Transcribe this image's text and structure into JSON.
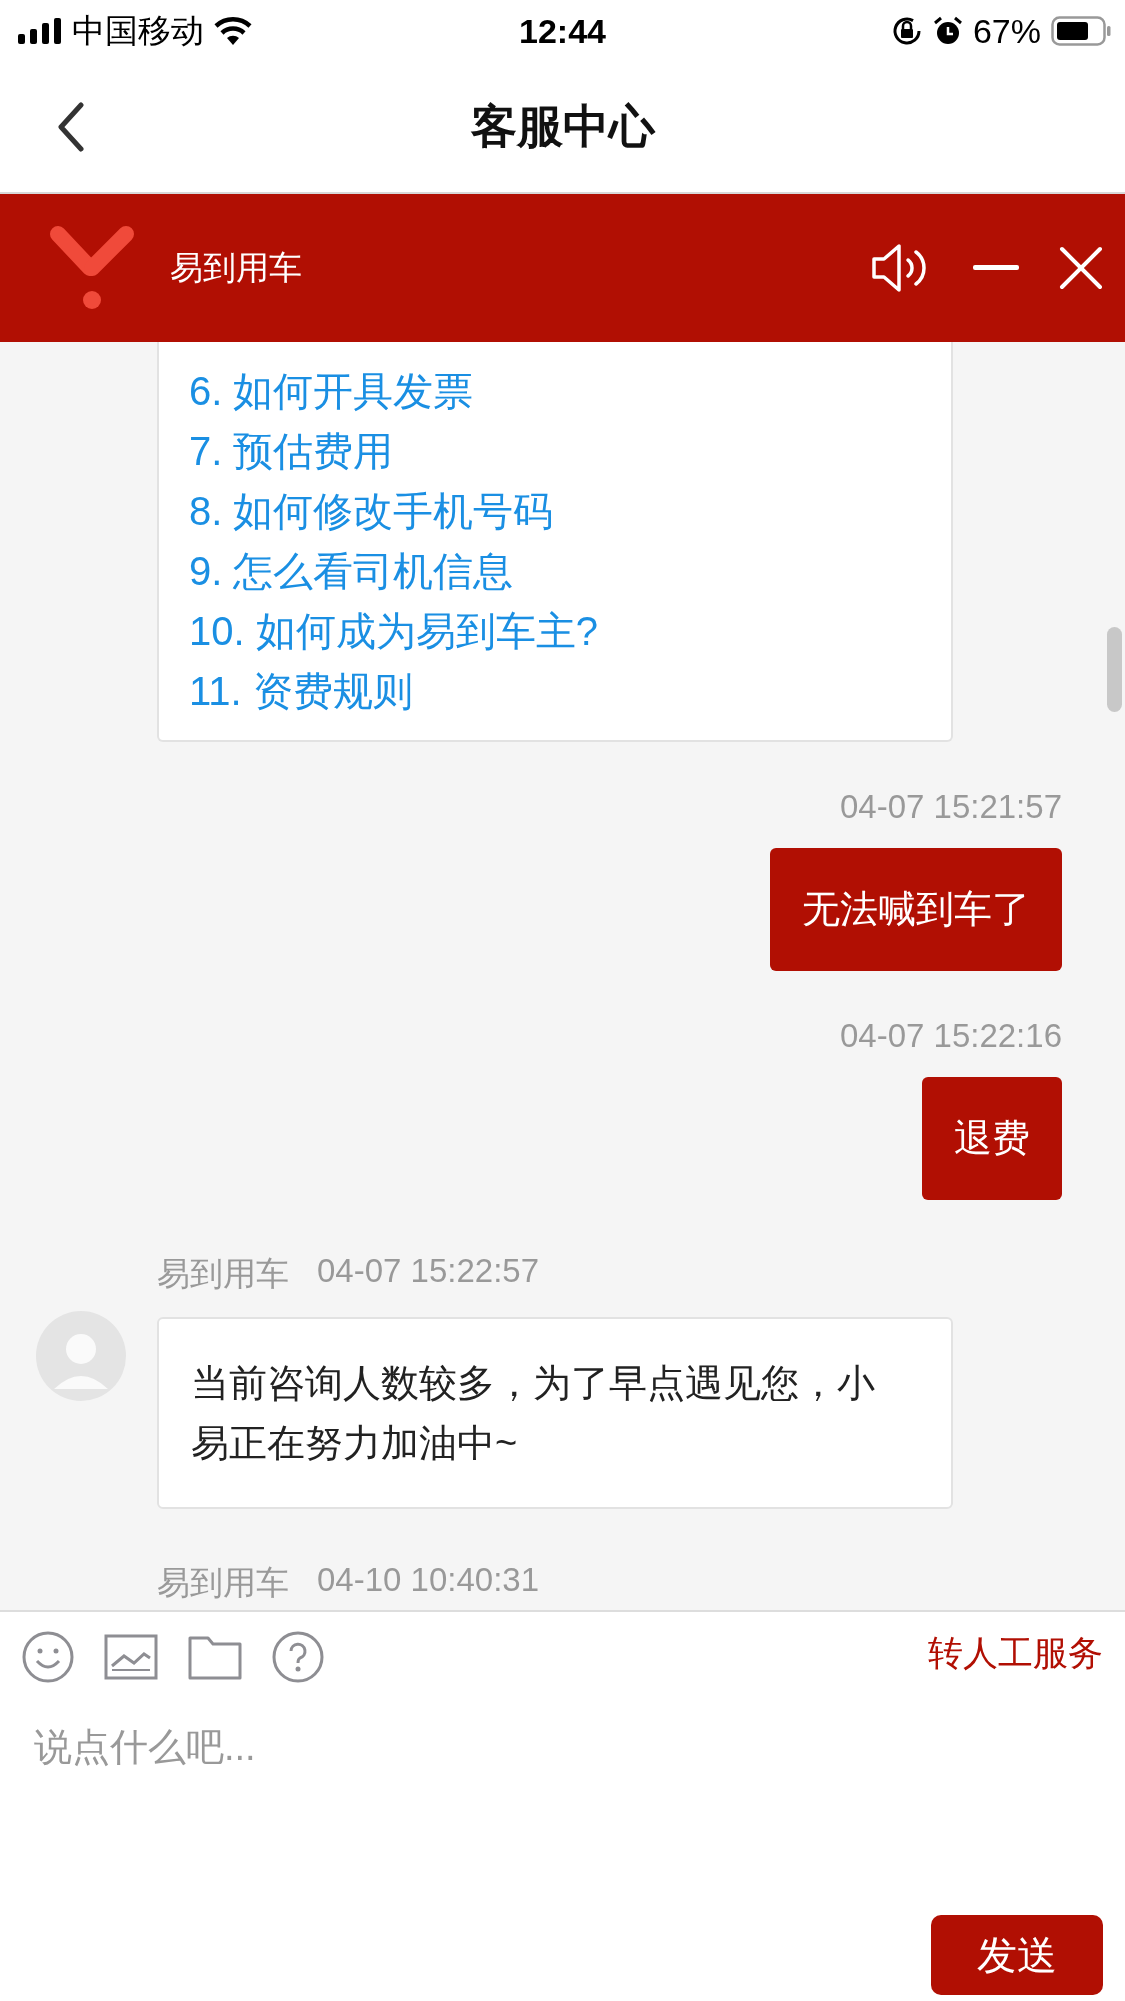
{
  "status_bar": {
    "carrier": "中国移动",
    "time": "12:44",
    "battery": "67%"
  },
  "nav": {
    "title": "客服中心"
  },
  "banner": {
    "title": "易到用车"
  },
  "faq": {
    "items": [
      "6. 如何开具发票",
      "7. 预估费用",
      "8. 如何修改手机号码",
      "9. 怎么看司机信息",
      "10. 如何成为易到车主?",
      "11. 资费规则"
    ]
  },
  "messages": [
    {
      "kind": "time",
      "text": "04-07 15:21:57"
    },
    {
      "kind": "user",
      "text": "无法喊到车了"
    },
    {
      "kind": "time",
      "text": "04-07 15:22:16"
    },
    {
      "kind": "user",
      "text": "退费"
    },
    {
      "kind": "bot",
      "sender": "易到用车",
      "time": "04-07 15:22:57",
      "text": "当前咨询人数较多，为了早点遇见您，小易正在努力加油中~"
    },
    {
      "kind": "bot_header",
      "sender": "易到用车",
      "time": "04-10 10:40:31"
    }
  ],
  "composer": {
    "transfer": "转人工服务",
    "placeholder": "说点什么吧...",
    "send": "发送"
  }
}
